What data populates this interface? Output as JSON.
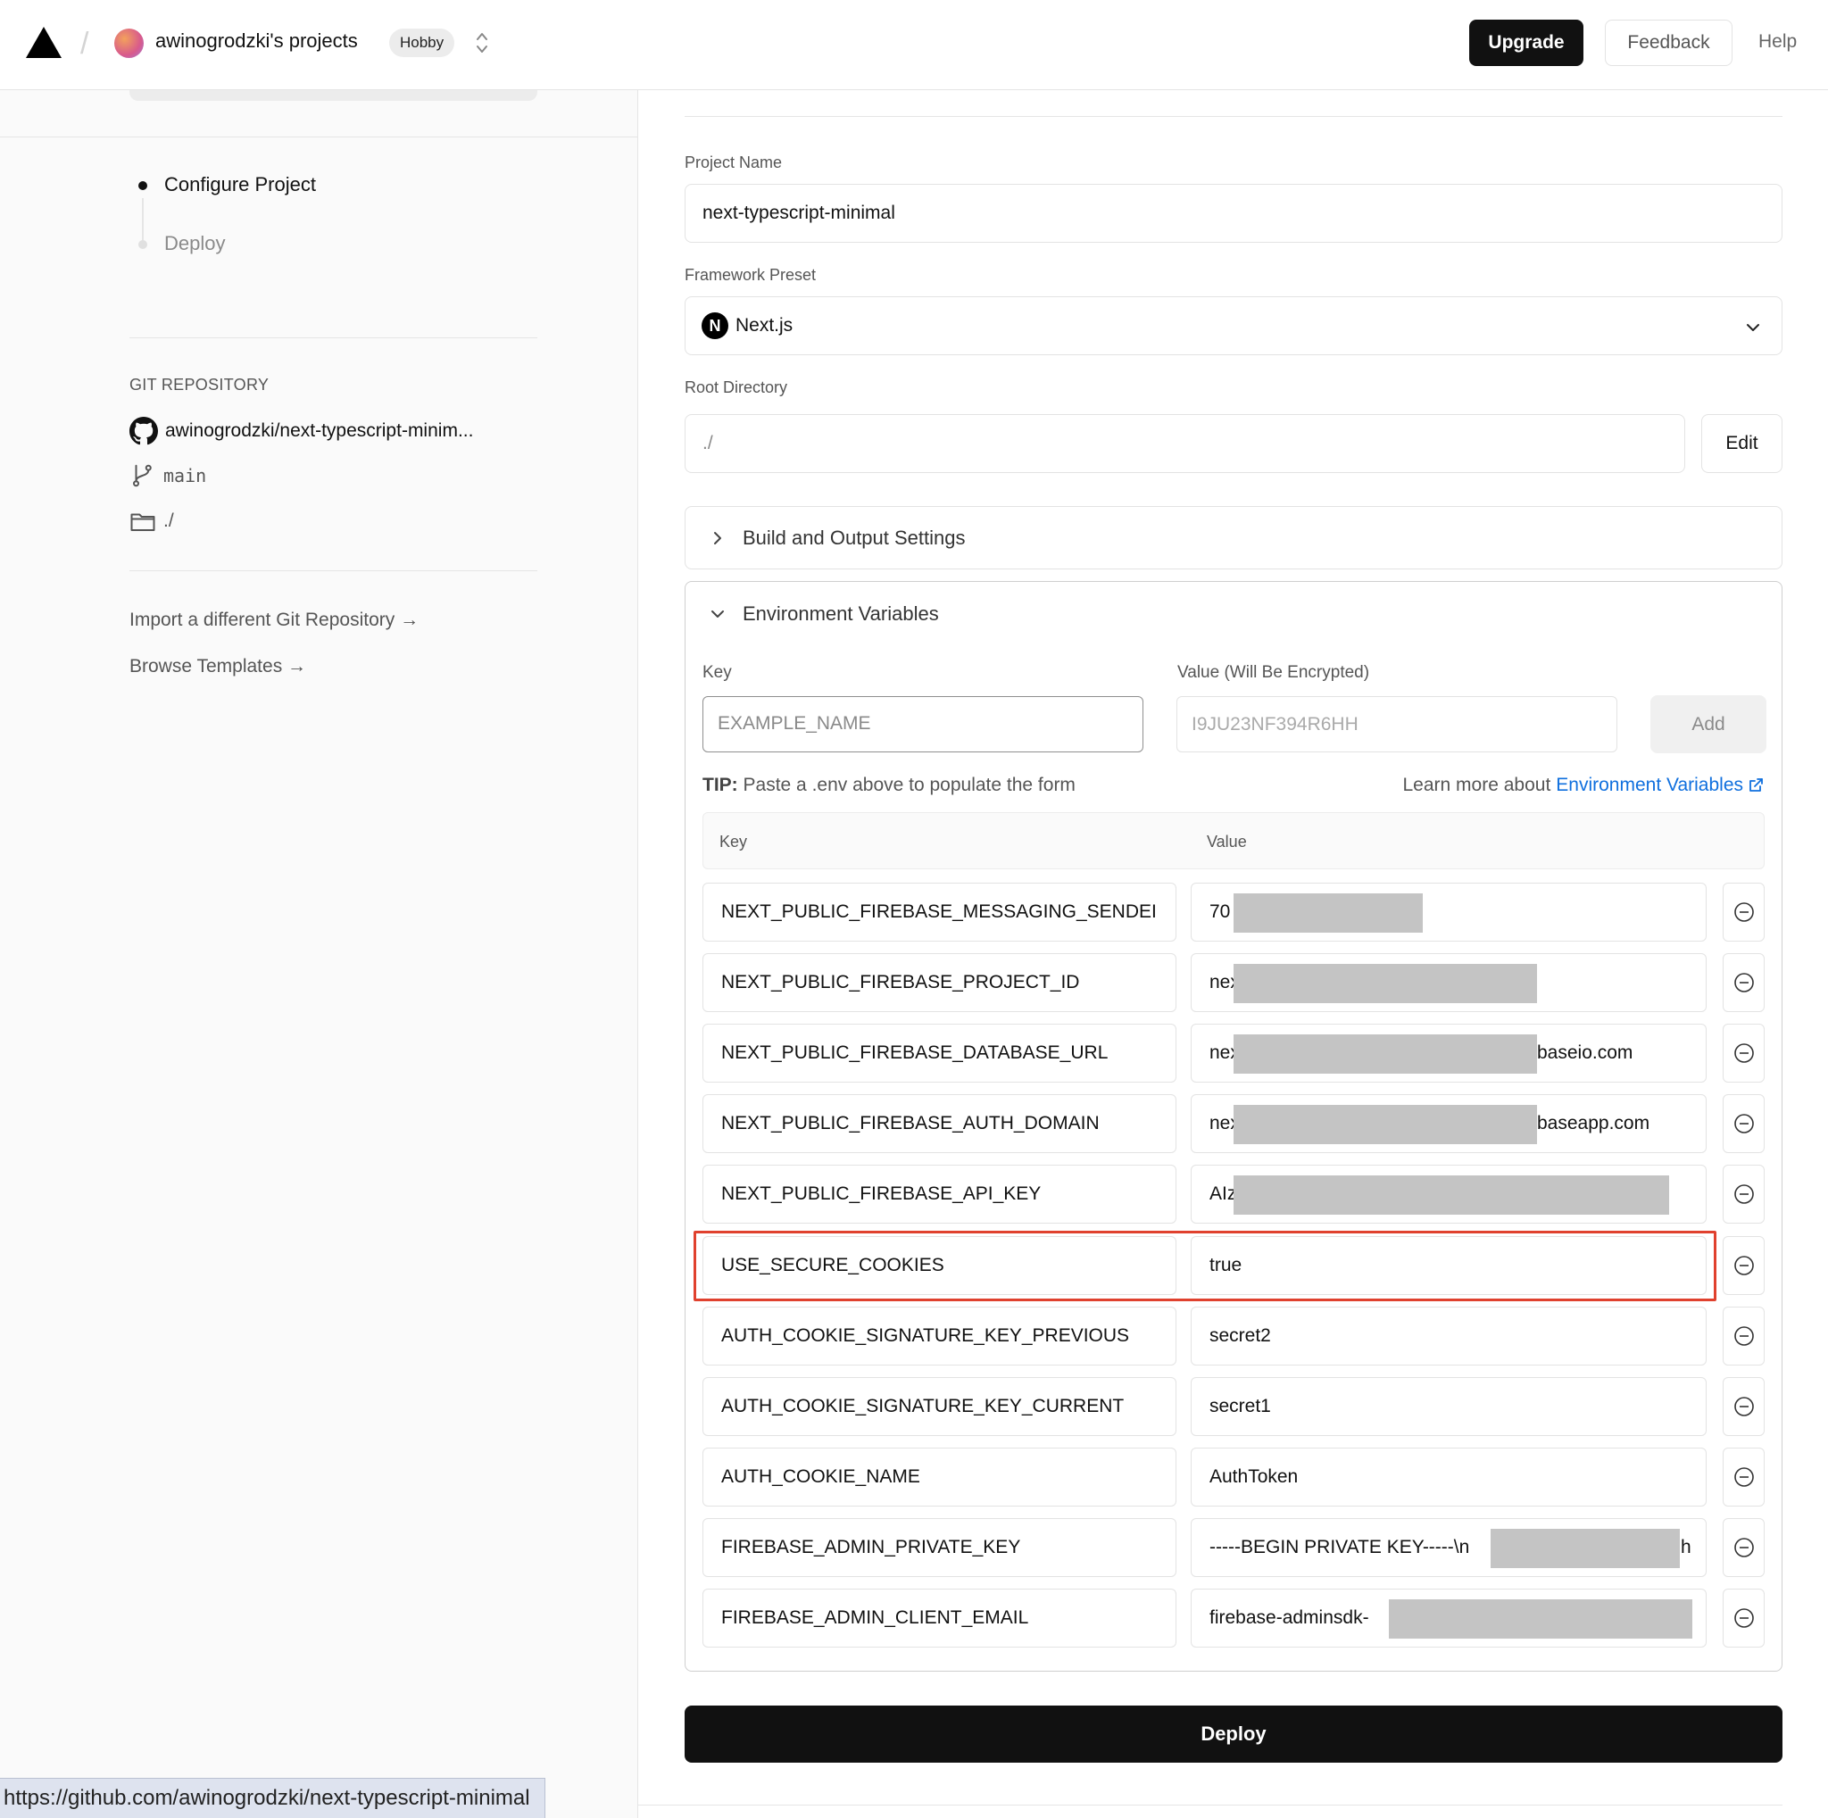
{
  "header": {
    "team_name": "awinogrodzki's projects",
    "plan_badge": "Hobby",
    "upgrade_label": "Upgrade",
    "feedback_label": "Feedback",
    "help_label": "Help"
  },
  "sidebar": {
    "steps": [
      {
        "label": "Configure Project",
        "active": true
      },
      {
        "label": "Deploy",
        "active": false
      }
    ],
    "git_heading": "GIT REPOSITORY",
    "repo": "awinogrodzki/next-typescript-minim...",
    "branch": "main",
    "directory": "./",
    "links": [
      {
        "label": "Import a different Git Repository →"
      },
      {
        "label": "Browse Templates →"
      }
    ]
  },
  "form": {
    "project_name_label": "Project Name",
    "project_name_value": "next-typescript-minimal",
    "framework_label": "Framework Preset",
    "framework_value": "Next.js",
    "root_dir_label": "Root Directory",
    "root_dir_value": "./",
    "edit_label": "Edit",
    "build_settings_label": "Build and Output Settings",
    "env_section_label": "Environment Variables"
  },
  "env": {
    "key_label": "Key",
    "value_label": "Value (Will Be Encrypted)",
    "key_placeholder": "EXAMPLE_NAME",
    "value_placeholder": "I9JU23NF394R6HH",
    "add_label": "Add",
    "tip_prefix": "TIP:",
    "tip_text": "Paste a .env above to populate the form",
    "learn_text": "Learn more about",
    "learn_link": "Environment Variables",
    "table_key_header": "Key",
    "table_value_header": "Value",
    "rows": [
      {
        "key": "NEXT_PUBLIC_FIREBASE_MESSAGING_SENDEI",
        "value": "70",
        "value_tail": ""
      },
      {
        "key": "NEXT_PUBLIC_FIREBASE_PROJECT_ID",
        "value": "nex",
        "value_tail": ""
      },
      {
        "key": "NEXT_PUBLIC_FIREBASE_DATABASE_URL",
        "value": "nex",
        "value_tail": "baseio.com"
      },
      {
        "key": "NEXT_PUBLIC_FIREBASE_AUTH_DOMAIN",
        "value": "nex",
        "value_tail": "baseapp.com"
      },
      {
        "key": "NEXT_PUBLIC_FIREBASE_API_KEY",
        "value": "AIz",
        "value_tail": ""
      },
      {
        "key": "USE_SECURE_COOKIES",
        "value": "true",
        "value_tail": ""
      },
      {
        "key": "AUTH_COOKIE_SIGNATURE_KEY_PREVIOUS",
        "value": "secret2",
        "value_tail": ""
      },
      {
        "key": "AUTH_COOKIE_SIGNATURE_KEY_CURRENT",
        "value": "secret1",
        "value_tail": ""
      },
      {
        "key": "AUTH_COOKIE_NAME",
        "value": "AuthToken",
        "value_tail": ""
      },
      {
        "key": "FIREBASE_ADMIN_PRIVATE_KEY",
        "value": "-----BEGIN PRIVATE KEY-----\\n",
        "value_tail": "h"
      },
      {
        "key": "FIREBASE_ADMIN_CLIENT_EMAIL",
        "value": "firebase-adminsdk-",
        "value_tail": ""
      }
    ]
  },
  "deploy_label": "Deploy",
  "status_url": "https://github.com/awinogrodzki/next-typescript-minimal",
  "colors": {
    "accent_link": "#0f6fde",
    "highlight_border": "#e0412e",
    "primary_button": "#111111"
  }
}
